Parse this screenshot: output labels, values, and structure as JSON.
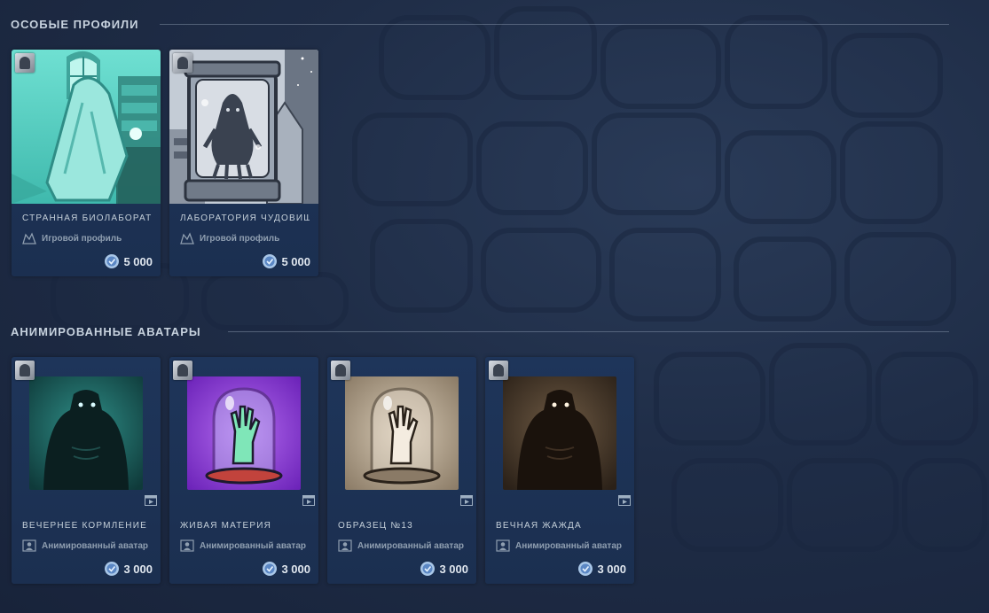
{
  "sections": [
    {
      "title": "ОСОБЫЕ ПРОФИЛИ",
      "items": [
        {
          "name": "СТРАННАЯ БИОЛАБОРАТОРИЯ",
          "type": "Игровой профиль",
          "price": "5 000"
        },
        {
          "name": "ЛАБОРАТОРИЯ ЧУДОВИЩ",
          "type": "Игровой профиль",
          "price": "5 000"
        }
      ]
    },
    {
      "title": "АНИМИРОВАННЫЕ АВАТАРЫ",
      "items": [
        {
          "name": "ВЕЧЕРНЕЕ КОРМЛЕНИЕ",
          "type": "Анимированный аватар",
          "price": "3 000"
        },
        {
          "name": "ЖИВАЯ МАТЕРИЯ",
          "type": "Анимированный аватар",
          "price": "3 000"
        },
        {
          "name": "ОБРАЗЕЦ №13",
          "type": "Анимированный аватар",
          "price": "3 000"
        },
        {
          "name": "ВЕЧНАЯ ЖАЖДА",
          "type": "Анимированный аватар",
          "price": "3 000"
        }
      ]
    }
  ],
  "icons": {
    "game_badge": "game-badge-icon",
    "profile_type": "profile-icon",
    "avatar_type": "avatar-icon",
    "points": "steam-points-icon",
    "animated": "animated-icon"
  },
  "colors": {
    "background": "#1f2d47",
    "card": "#1e355a",
    "teal": "#5fd4c8",
    "purple": "#8a3fd1"
  }
}
